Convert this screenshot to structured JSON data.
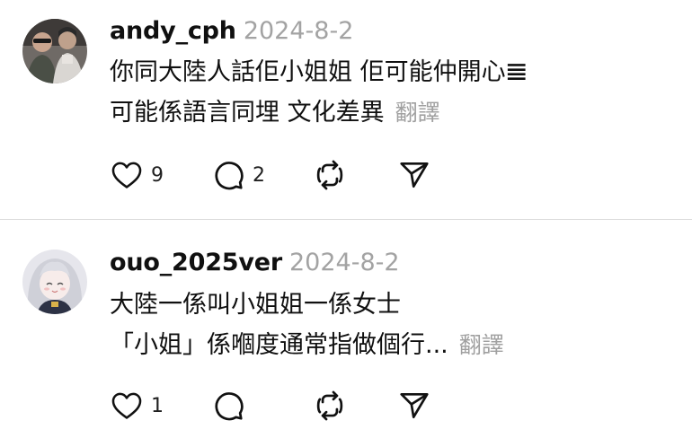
{
  "posts": [
    {
      "username": "andy_cph",
      "date": "2024-8-2",
      "lines": [
        "你同大陸人話佢小姐姐 佢可能仲開心𝌆",
        "可能係語言同埋 文化差異"
      ],
      "translate_label": "翻譯",
      "likes": "9",
      "replies": "2",
      "reposts": ""
    },
    {
      "username": "ouo_2025ver",
      "date": "2024-8-2",
      "lines": [
        "大陸一係叫小姐姐一係女士",
        "「小姐」係嗰度通常指做個行..."
      ],
      "translate_label": "翻譯",
      "likes": "1",
      "replies": "",
      "reposts": ""
    }
  ],
  "icons": {
    "like": "heart-icon",
    "reply": "comment-bubble-icon",
    "repost": "repost-icon",
    "share": "send-icon"
  }
}
